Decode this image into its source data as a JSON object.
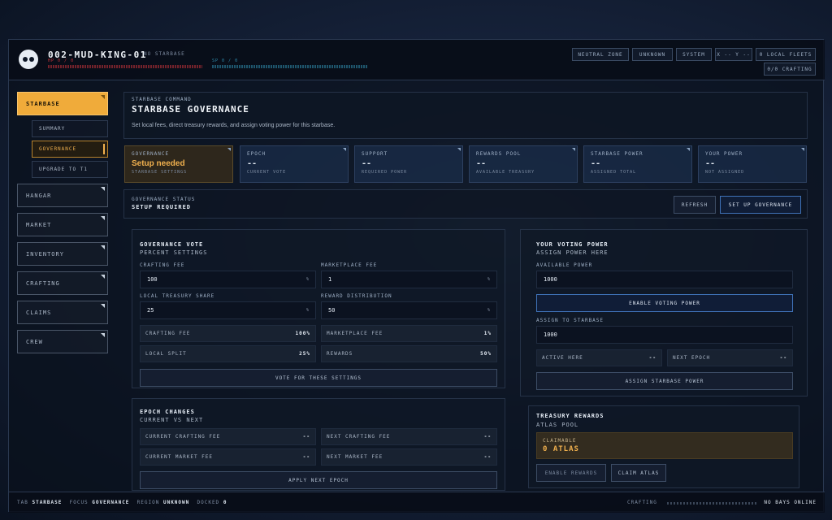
{
  "player": {
    "name": "002-MUD-KING-01",
    "starbase_status": "NO STARBASE",
    "hp_label": "HP 0 / 0",
    "sp_label": "SP 0 / 0"
  },
  "top_chips": {
    "zone": "NEUTRAL ZONE",
    "region": "UNKNOWN",
    "system": "SYSTEM",
    "coords": "X -- Y --",
    "fleets": "0 LOCAL FLEETS",
    "crafting": "0/0 CRAFTING"
  },
  "sidebar": {
    "items": [
      "STARBASE",
      "HANGAR",
      "MARKET",
      "INVENTORY",
      "CRAFTING",
      "CLAIMS",
      "CREW"
    ],
    "sub_items": [
      "SUMMARY",
      "GOVERNANCE",
      "UPGRADE TO T1"
    ]
  },
  "header": {
    "eyebrow": "STARBASE COMMAND",
    "title": "STARBASE GOVERNANCE",
    "desc": "Set local fees, direct treasury rewards, and assign voting power for this starbase."
  },
  "stats": [
    {
      "title": "GOVERNANCE",
      "value": "Setup needed",
      "sub": "STARBASE SETTINGS"
    },
    {
      "title": "EPOCH",
      "value": "--",
      "sub": "CURRENT VOTE"
    },
    {
      "title": "SUPPORT",
      "value": "--",
      "sub": "REQUIRED POWER"
    },
    {
      "title": "REWARDS POOL",
      "value": "--",
      "sub": "AVAILABLE TREASURY"
    },
    {
      "title": "STARBASE POWER",
      "value": "--",
      "sub": "ASSIGNED TOTAL"
    },
    {
      "title": "YOUR POWER",
      "value": "--",
      "sub": "NOT ASSIGNED"
    }
  ],
  "status": {
    "label": "GOVERNANCE STATUS",
    "value": "SETUP REQUIRED",
    "refresh": "REFRESH",
    "setup": "SET UP GOVERNANCE"
  },
  "vote": {
    "title": "GOVERNANCE VOTE",
    "subtitle": "PERCENT SETTINGS",
    "crafting_fee_label": "CRAFTING FEE",
    "crafting_fee": "100",
    "marketplace_fee_label": "MARKETPLACE FEE",
    "marketplace_fee": "1",
    "treasury_label": "LOCAL TREASURY SHARE",
    "treasury": "25",
    "reward_label": "REWARD DISTRIBUTION",
    "reward": "50",
    "unit": "%",
    "summary": [
      {
        "k": "CRAFTING FEE",
        "v": "100%"
      },
      {
        "k": "MARKETPLACE FEE",
        "v": "1%"
      },
      {
        "k": "LOCAL SPLIT",
        "v": "25%"
      },
      {
        "k": "REWARDS",
        "v": "50%"
      }
    ],
    "vote_button": "VOTE FOR THESE SETTINGS"
  },
  "epoch": {
    "title": "EPOCH CHANGES",
    "subtitle": "CURRENT VS NEXT",
    "rows": [
      {
        "k": "CURRENT CRAFTING FEE",
        "v": "--"
      },
      {
        "k": "NEXT CRAFTING FEE",
        "v": "--"
      },
      {
        "k": "CURRENT MARKET FEE",
        "v": "--"
      },
      {
        "k": "NEXT MARKET FEE",
        "v": "--"
      }
    ],
    "apply_button": "APPLY NEXT EPOCH"
  },
  "power": {
    "title": "YOUR VOTING POWER",
    "subtitle": "ASSIGN POWER HERE",
    "available_label": "AVAILABLE POWER",
    "available": "1000",
    "enable_button": "ENABLE VOTING POWER",
    "assign_label": "ASSIGN TO STARBASE",
    "assign": "1000",
    "active_label": "ACTIVE HERE",
    "active": "--",
    "next_label": "NEXT EPOCH",
    "next": "--",
    "assign_button": "ASSIGN STARBASE POWER"
  },
  "treasury": {
    "title": "TREASURY REWARDS",
    "subtitle": "ATLAS POOL",
    "claimable_label": "CLAIMABLE",
    "claimable": "0 ATLAS",
    "enable_button": "ENABLE REWARDS",
    "claim_button": "CLAIM ATLAS"
  },
  "footer": {
    "tab_label": "TAB",
    "tab": "STARBASE",
    "focus_label": "FOCUS",
    "focus": "GOVERNANCE",
    "region_label": "REGION",
    "region": "UNKNOWN",
    "docked_label": "DOCKED",
    "docked": "0",
    "crafting_label": "CRAFTING",
    "bays": "NO BAYS ONLINE"
  },
  "colors": {
    "accent": "#f0ab3a",
    "primary": "#3f72b8",
    "hp": "#c8333a",
    "sp": "#2f8fb0"
  }
}
